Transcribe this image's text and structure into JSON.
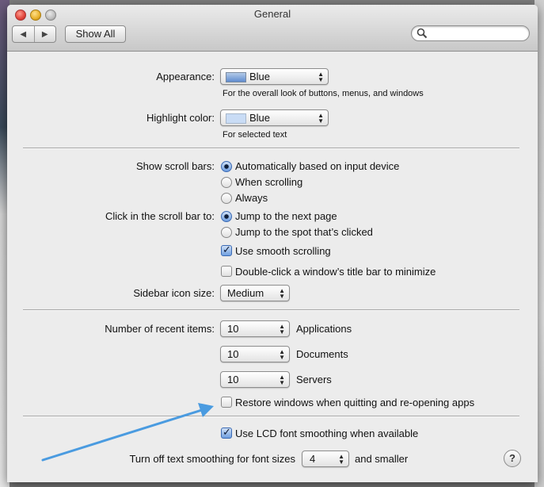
{
  "window": {
    "title": "General"
  },
  "toolbar": {
    "back_glyph": "◀",
    "forward_glyph": "▶",
    "show_all_label": "Show All",
    "search_value": "",
    "search_placeholder": ""
  },
  "appearance": {
    "label": "Appearance:",
    "value": "Blue",
    "description": "For the overall look of buttons, menus, and windows",
    "swatch_color": "#6f97d6"
  },
  "highlight": {
    "label": "Highlight color:",
    "value": "Blue",
    "description": "For selected text",
    "swatch_color": "#c9dcf5"
  },
  "scroll_bars": {
    "label": "Show scroll bars:",
    "options": [
      {
        "label": "Automatically based on input device",
        "selected": true
      },
      {
        "label": "When scrolling",
        "selected": false
      },
      {
        "label": "Always",
        "selected": false
      }
    ]
  },
  "scroll_click": {
    "label": "Click in the scroll bar to:",
    "options": [
      {
        "label": "Jump to the next page",
        "selected": true
      },
      {
        "label": "Jump to the spot that’s clicked",
        "selected": false
      }
    ]
  },
  "smooth_scrolling": {
    "label": "Use smooth scrolling",
    "checked": true
  },
  "double_click_minimize": {
    "label": "Double-click a window’s title bar to minimize",
    "checked": false
  },
  "sidebar_icon": {
    "label": "Sidebar icon size:",
    "value": "Medium"
  },
  "recent_items": {
    "label": "Number of recent items:",
    "rows": [
      {
        "value": "10",
        "label": "Applications"
      },
      {
        "value": "10",
        "label": "Documents"
      },
      {
        "value": "10",
        "label": "Servers"
      }
    ]
  },
  "restore_windows": {
    "label": "Restore windows when quitting and re-opening apps",
    "checked": false
  },
  "lcd_smoothing": {
    "label": "Use LCD font smoothing when available",
    "checked": true
  },
  "text_smoothing": {
    "label": "Turn off text smoothing for font sizes",
    "value": "4",
    "suffix": "and smaller"
  },
  "help": {
    "glyph": "?"
  },
  "annotation_arrow": {
    "color": "#4a9be0"
  },
  "colors": {
    "accent": "#3b6ab3",
    "window_bg": "#ececec"
  }
}
